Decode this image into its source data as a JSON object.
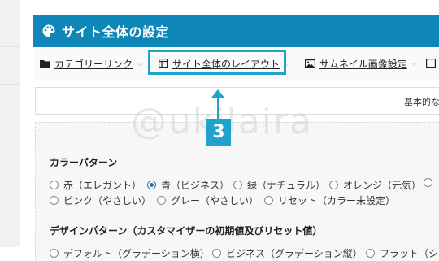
{
  "panel_title": "サイト全体の設定",
  "tabs": [
    {
      "label": "カテゴリーリンク",
      "icon": "folder-icon"
    },
    {
      "label": "サイト全体のレイアウト",
      "icon": "layout-icon"
    },
    {
      "label": "サムネイル画像設定",
      "icon": "image-icon"
    }
  ],
  "callout": {
    "number": "3",
    "color": "#1fa2cc"
  },
  "description": "基本的な方",
  "watermark": "@ukilaira",
  "color_pattern": {
    "title": "カラーパターン",
    "options": [
      {
        "label": "赤（エレガント）",
        "selected": false
      },
      {
        "label": "青（ビジネス）",
        "selected": true
      },
      {
        "label": "緑（ナチュラル）",
        "selected": false
      },
      {
        "label": "オレンジ（元気）",
        "selected": false
      },
      {
        "label": "ピンク（やさしい）",
        "selected": false
      },
      {
        "label": "グレー（やさしい）",
        "selected": false
      },
      {
        "label": "リセット（カラー未設定）",
        "selected": false
      }
    ]
  },
  "design_pattern": {
    "title": "デザインパターン（カスタマイザーの初期値及びリセット値）",
    "options": [
      {
        "label": "デフォルト（グラデーション横）",
        "selected": false
      },
      {
        "label": "ビジネス（グラデーション縦）",
        "selected": false
      },
      {
        "label": "フラット（シ",
        "selected": false
      }
    ]
  },
  "colors": {
    "header": "#0f86b8",
    "accent": "#1fa2cc",
    "radio_selected": "#2271b1"
  }
}
